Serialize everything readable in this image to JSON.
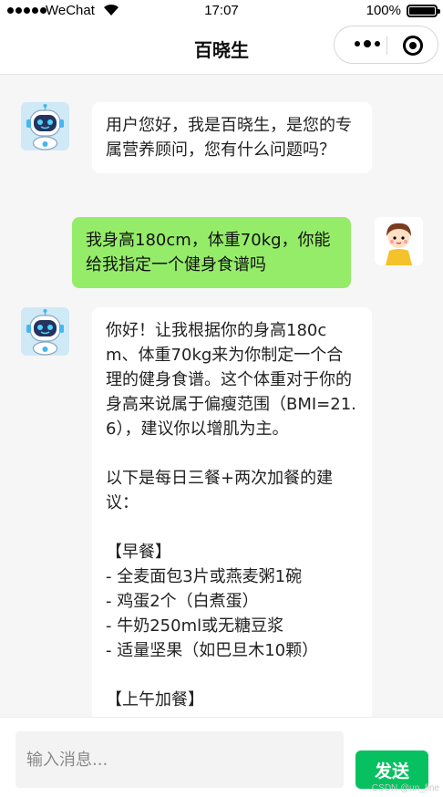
{
  "status_bar": {
    "carrier": "WeChat",
    "time": "17:07",
    "battery": "100%"
  },
  "nav": {
    "title": "百晓生"
  },
  "messages": [
    {
      "role": "bot",
      "avatar": "robot-avatar-icon",
      "text": "用户您好，我是百晓生，是您的专属营养顾问，您有什么问题吗？"
    },
    {
      "role": "user",
      "avatar": "user-avatar-icon",
      "text": "我身高180cm，体重70kg，你能给我指定一个健身食谱吗"
    },
    {
      "role": "bot",
      "avatar": "robot-avatar-icon",
      "text": "你好！让我根据你的身高180cm、体重70kg来为你制定一个合理的健身食谱。这个体重对于你的身高来说属于偏瘦范围（BMI=21.6），建议你以增肌为主。\n\n以下是每日三餐+两次加餐的建议：\n\n【早餐】\n- 全麦面包3片或燕麦粥1碗\n- 鸡蛋2个（白煮蛋）\n- 牛奶250ml或无糖豆浆\n- 适量坚果（如巴旦木10颗）\n\n【上午加餐】"
    }
  ],
  "input": {
    "placeholder": "输入消息...",
    "value": ""
  },
  "send_button": {
    "label": "发送"
  },
  "watermark": "CSDN @un_fine",
  "colors": {
    "user_bubble": "#95ec69",
    "send_button": "#07c160",
    "background": "#f6f6f6"
  }
}
